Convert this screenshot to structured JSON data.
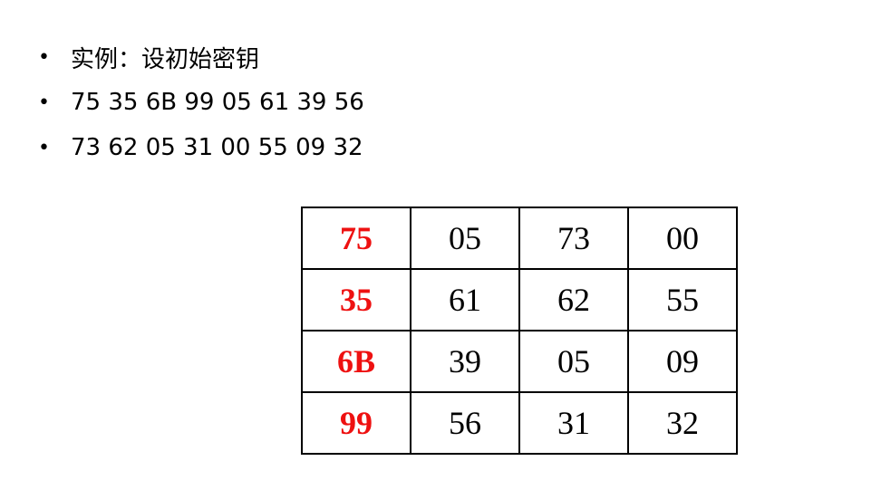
{
  "bullets": [
    "实例：设初始密钥",
    "75 35 6B 99 05 61 39 56",
    "73 62 05 31 00 55 09 32"
  ],
  "bullet_glyph": "•",
  "table": {
    "rows": [
      [
        "75",
        "05",
        "73",
        "00"
      ],
      [
        "35",
        "61",
        "62",
        "55"
      ],
      [
        "6B",
        "39",
        "05",
        "09"
      ],
      [
        "99",
        "56",
        "31",
        "32"
      ]
    ],
    "highlight_color": "#ee1111",
    "text_color": "#000000"
  }
}
